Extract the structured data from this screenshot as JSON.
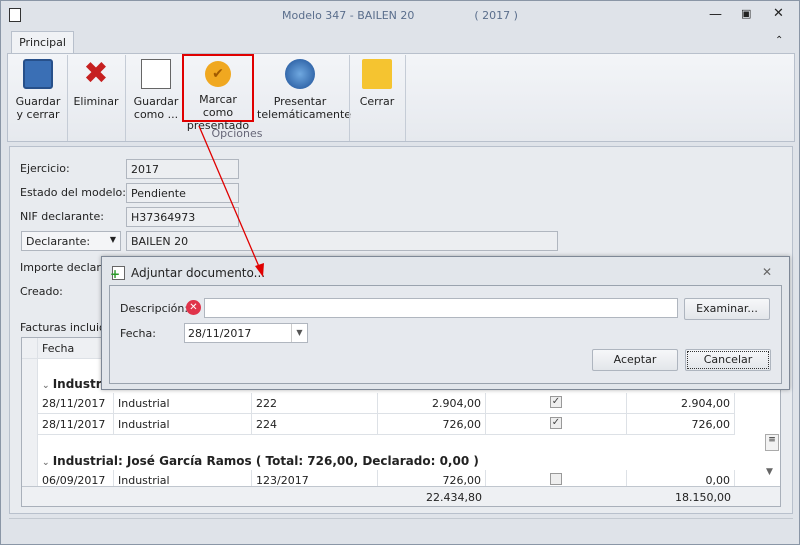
{
  "window": {
    "title": "Modelo 347 - BAILEN 20",
    "year": "( 2017 )"
  },
  "tabs": [
    {
      "label": "Principal"
    }
  ],
  "ribbon": {
    "buttons": [
      {
        "label1": "Guardar",
        "label2": "y cerrar"
      },
      {
        "label1": "Eliminar",
        "label2": ""
      },
      {
        "label1": "Guardar",
        "label2": "como ..."
      },
      {
        "label1": "Marcar como",
        "label2": "presentado"
      },
      {
        "label1": "Presentar",
        "label2": "telemáticamente"
      },
      {
        "label1": "Cerrar",
        "label2": ""
      }
    ],
    "group_label": "Opciones"
  },
  "form": {
    "ejercicio_label": "Ejercicio:",
    "ejercicio": "2017",
    "estado_label": "Estado del modelo:",
    "estado": "Pendiente",
    "nif_label": "NIF declarante:",
    "nif": "H37364973",
    "declarante_select": "Declarante:",
    "declarante": "BAILEN 20",
    "importe_label": "Importe declarado:",
    "creado_label": "Creado:",
    "facturas_label": "Facturas incluidas"
  },
  "grid": {
    "header": [
      "Fecha"
    ],
    "group1": "Industrial",
    "rows1": [
      [
        "28/11/2017",
        "Industrial",
        "222",
        "2.904,00",
        true,
        "2.904,00"
      ],
      [
        "28/11/2017",
        "Industrial",
        "224",
        "726,00",
        true,
        "726,00"
      ]
    ],
    "group2": "Industrial: José García Ramos ( Total: 726,00, Declarado: 0,00 )",
    "rows2": [
      [
        "06/09/2017",
        "Industrial",
        "123/2017",
        "726,00",
        false,
        "0,00"
      ]
    ],
    "footer": {
      "total": "22.434,80",
      "declarado": "18.150,00"
    }
  },
  "dialog": {
    "title": "Adjuntar documento...",
    "descripcion_label": "Descripción:",
    "descripcion": "",
    "fecha_label": "Fecha:",
    "fecha": "28/11/2017",
    "examinar": "Examinar...",
    "aceptar": "Aceptar",
    "cancelar": "Cancelar"
  },
  "colors": {
    "highlight": "#e00000",
    "error": "#e0334a"
  }
}
